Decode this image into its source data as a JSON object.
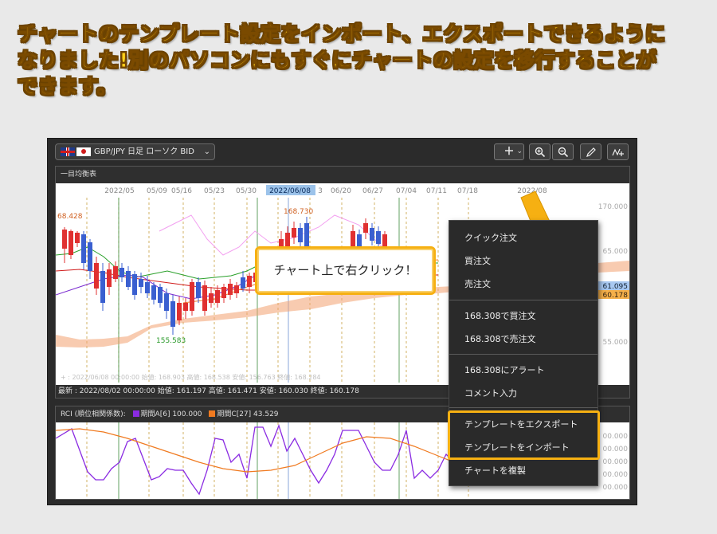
{
  "headline": {
    "line1": "チャートのテンプレート設定をインポート、エクスポートできるように",
    "line2": "なりました!別のパソコンにもすぐにチャートの設定を移行することが",
    "line3": "できます。"
  },
  "toolbar": {
    "symbol": "GBP/JPY 日足 ローソク BID",
    "add_icon": "plus-icon",
    "zoom_in_icon": "zoom-in-icon",
    "zoom_out_icon": "zoom-out-icon",
    "draw_icon": "pencil-icon",
    "indicator_icon": "indicator-add-icon"
  },
  "chart": {
    "panel_title": "一目均衡表",
    "date_labels": [
      "2022/05",
      "05/09",
      "05/16",
      "05/23",
      "05/30",
      "2022/06/08",
      "3",
      "06/20",
      "06/27",
      "07/04",
      "07/11",
      "07/18",
      "2022/08"
    ],
    "high_label": "68.428",
    "marker_high": "168.730",
    "marker_low": "155.583",
    "axis_prices": [
      "170.000",
      "65.000",
      "61.095",
      "60.178",
      "55.000"
    ],
    "ohlc_ghost": "+ : 2022/06/08 00:00:00  始値: 168.903  高値: 168.538  安値: 156.763  終値: 168.284",
    "status": "最新 : 2022/08/02 00:00:00  始値: 161.197  高値: 161.471  安値: 160.030  終値: 160.178",
    "colors": {
      "up": "#e03030",
      "down": "#3a5fd0",
      "tenkan": "#d01c1c",
      "kijun": "#2aa02a",
      "senkou_a": "#f08030",
      "chikou": "#7a2ad0",
      "cloud": "#f3a070"
    }
  },
  "rci": {
    "title": "RCI (順位相関係数):",
    "series_a": "期間A[6] 100.000",
    "series_c": "期間C[27] 43.529",
    "color_a": "#8a2be2",
    "color_c": "#f07a20",
    "axis_labels": [
      "00.000",
      "00.000",
      "00.000",
      "00.000",
      "00.000"
    ]
  },
  "callout": {
    "text": "チャート上で右クリック！"
  },
  "context_menu": {
    "items": [
      "クイック注文",
      "買注文",
      "売注文",
      "168.308で買注文",
      "168.308で売注文",
      "168.308にアラート",
      "コメント入力",
      "テンプレートをエクスポート",
      "テンプレートをインポート",
      "チャートを複製"
    ]
  }
}
